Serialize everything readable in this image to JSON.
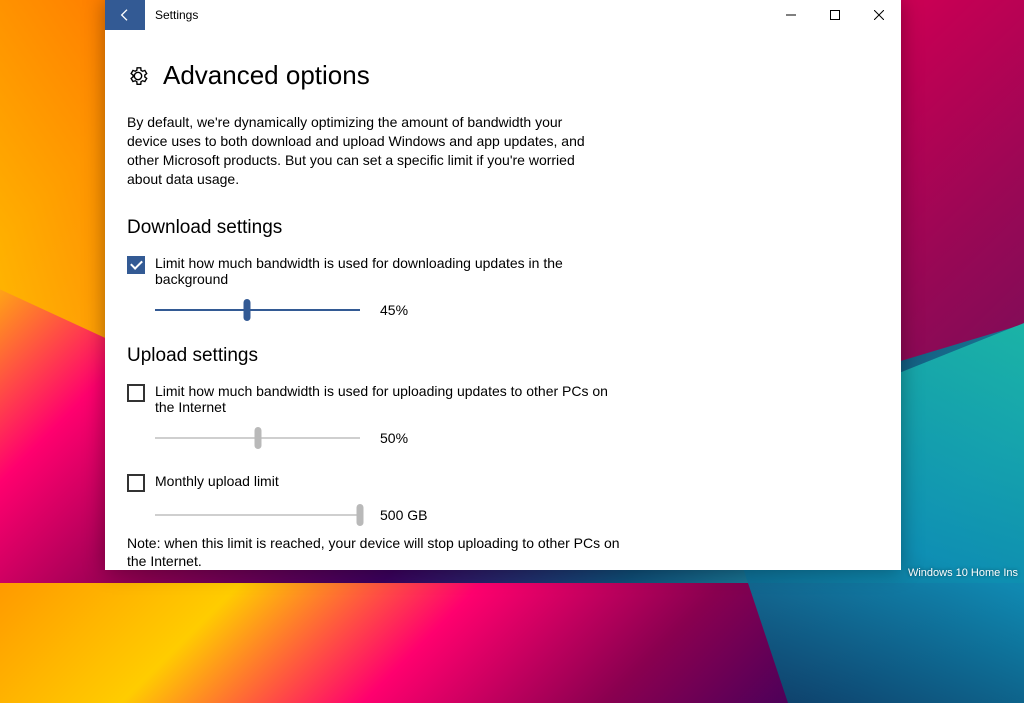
{
  "watermark": "Windows 10 Home Ins",
  "titlebar": {
    "title": "Settings"
  },
  "page": {
    "title": "Advanced options",
    "intro": "By default, we're dynamically optimizing the amount of bandwidth your device uses to both download and upload Windows and app updates, and other Microsoft products. But you can set a specific limit if you're worried about data usage."
  },
  "download": {
    "heading": "Download settings",
    "checkbox_label": "Limit how much bandwidth is used for downloading updates in the background",
    "checked": true,
    "slider_percent": 45,
    "slider_display": "45%"
  },
  "upload": {
    "heading": "Upload settings",
    "checkbox_label": "Limit how much bandwidth is used for uploading updates to other PCs on the Internet",
    "checked": false,
    "slider_percent": 50,
    "slider_display": "50%",
    "monthly_checkbox_label": "Monthly upload limit",
    "monthly_checked": false,
    "monthly_slider_percent": 100,
    "monthly_display": "500 GB",
    "note": "Note: when this limit is reached, your device will stop uploading to other PCs on the Internet."
  }
}
